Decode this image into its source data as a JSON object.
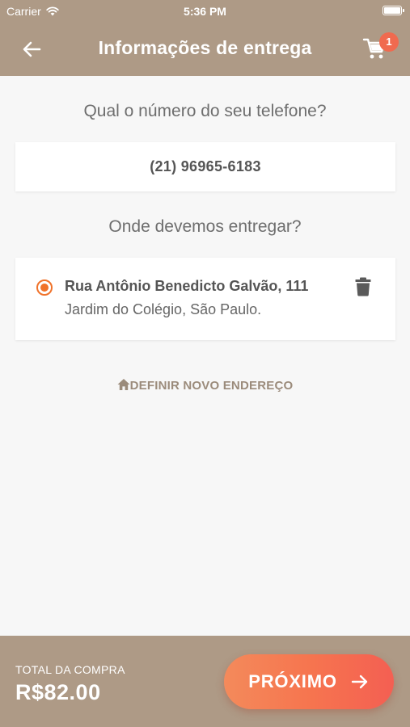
{
  "status_bar": {
    "carrier": "Carrier",
    "time": "5:36 PM"
  },
  "nav": {
    "title": "Informações de entrega",
    "cart_badge": "1",
    "back_icon": "arrow-left-icon",
    "cart_icon": "cart-icon"
  },
  "phone_section": {
    "question": "Qual o número do seu telefone?",
    "phone": "(21) 96965-6183"
  },
  "address_section": {
    "question": "Onde devemos entregar?",
    "addresses": [
      {
        "line1": "Rua Antônio Benedicto Galvão, 111",
        "line2": "Jardim do Colégio, São Paulo.",
        "selected": true
      }
    ],
    "new_address_label": "DEFINIR NOVO ENDEREÇO",
    "new_address_icon": "home-icon"
  },
  "footer": {
    "total_label": "TOTAL DA COMPRA",
    "total_value": "R$82.00",
    "next_label": "PRÓXIMO",
    "next_icon": "arrow-right-icon"
  },
  "colors": {
    "header_bg": "#ae9a86",
    "accent": "#f0722a",
    "badge": "#f06a4f",
    "button_gradient_start": "#f48a5b",
    "button_gradient_end": "#f45f52",
    "page_bg": "#f7f7f7"
  }
}
